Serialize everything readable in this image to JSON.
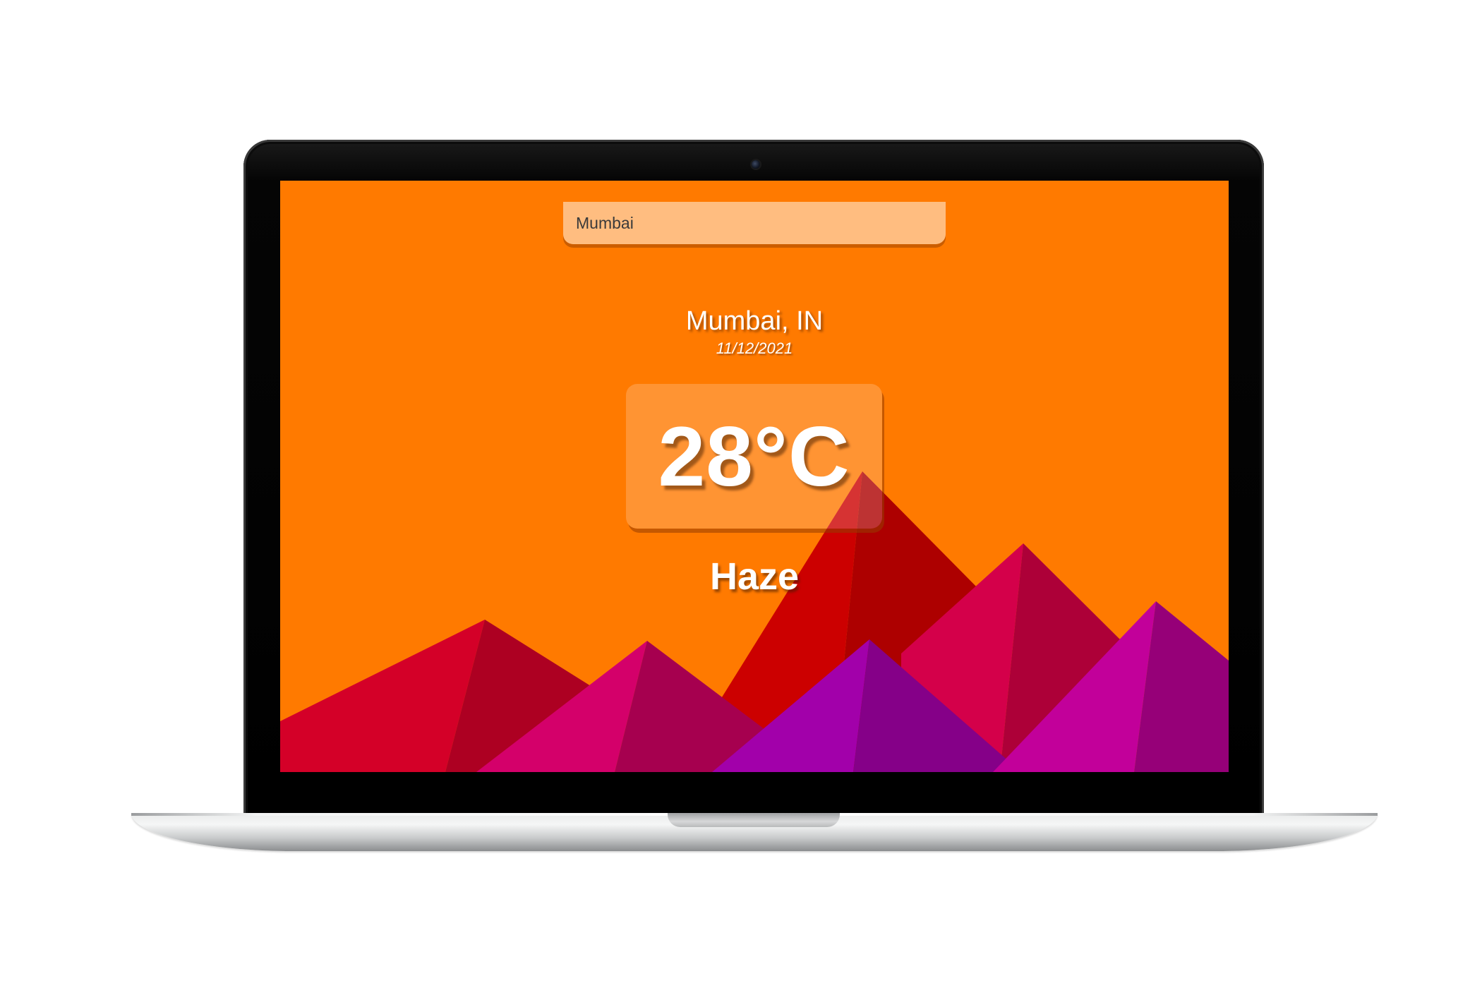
{
  "search": {
    "value": "Mumbai",
    "placeholder": ""
  },
  "weather": {
    "location": "Mumbai, IN",
    "date": "11/12/2021",
    "temperature": "28°C",
    "condition": "Haze"
  },
  "colors": {
    "background": "#ff7a00",
    "mountain_red": "#d40028",
    "mountain_crimson": "#cc0000",
    "mountain_magenta": "#d4006a",
    "mountain_purple": "#a000a8",
    "mountain_pink_purple": "#c2009a",
    "text": "#ffffff"
  }
}
